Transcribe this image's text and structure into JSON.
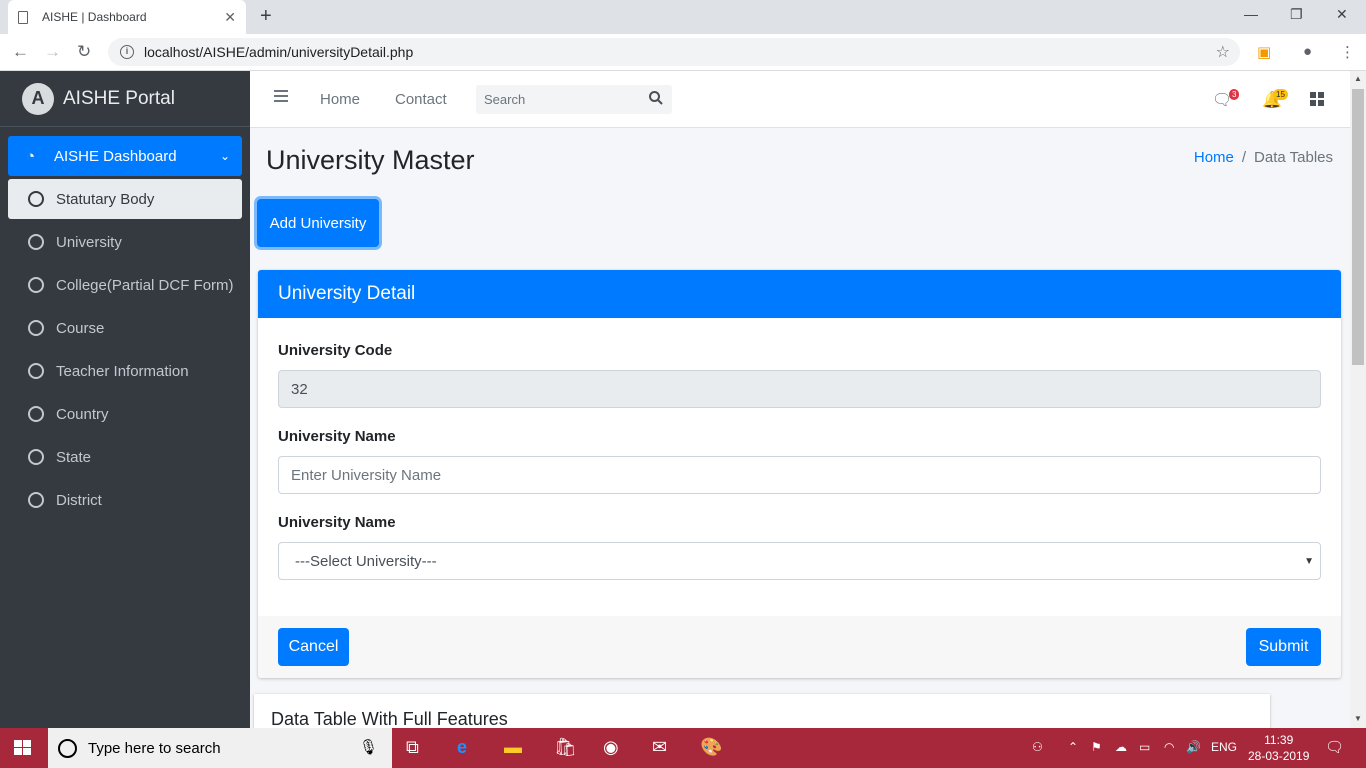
{
  "browser": {
    "tab_title": "AISHE | Dashboard",
    "url": "localhost/AISHE/admin/universityDetail.php"
  },
  "sidebar": {
    "brand": "AISHE Portal",
    "main_item": "AISHE Dashboard",
    "items": [
      {
        "label": "Statutary Body"
      },
      {
        "label": "University"
      },
      {
        "label": "College(Partial DCF Form)"
      },
      {
        "label": "Course"
      },
      {
        "label": "Teacher Information"
      },
      {
        "label": "Country"
      },
      {
        "label": "State"
      },
      {
        "label": "District"
      }
    ]
  },
  "topnav": {
    "links": [
      "Home",
      "Contact"
    ],
    "search_placeholder": "Search",
    "messages_count": "3",
    "notifications_count": "15",
    "messages_badge_color": "#dc3545",
    "notifications_badge_color": "#ffc107"
  },
  "page": {
    "title": "University Master",
    "breadcrumb": {
      "home": "Home",
      "current": "Data Tables"
    },
    "add_button": "Add University"
  },
  "form": {
    "header": "University Detail",
    "code_label": "University Code",
    "code_value": "32",
    "name_label": "University Name",
    "name_placeholder": "Enter University Name",
    "select_label": "University Name",
    "select_value": "---Select University---",
    "cancel": "Cancel",
    "submit": "Submit"
  },
  "datatable": {
    "title": "Data Table With Full Features"
  },
  "taskbar": {
    "search_placeholder": "Type here to search",
    "language": "ENG",
    "time": "11:39",
    "date": "28-03-2019"
  },
  "colors": {
    "primary": "#007bff",
    "sidebar_bg": "#343a40",
    "taskbar": "#a8283b"
  }
}
